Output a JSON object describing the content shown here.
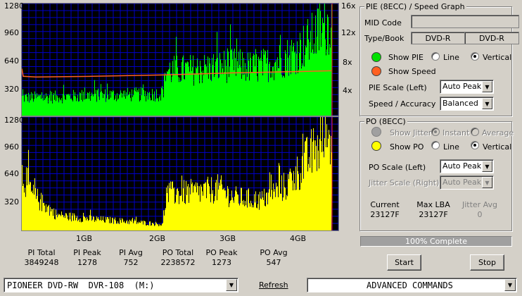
{
  "pie_graph": {
    "y_left": [
      "1280",
      "960",
      "640",
      "320"
    ],
    "y_right": [
      "16x",
      "12x",
      "8x",
      "4x"
    ]
  },
  "po_graph": {
    "y_left": [
      "1280",
      "960",
      "640",
      "320"
    ],
    "x_labels": [
      "1GB",
      "2GB",
      "3GB",
      "4GB"
    ]
  },
  "chart_data": [
    {
      "type": "area",
      "series": [
        {
          "name": "PIE",
          "color": "#00ff00",
          "x": [
            0,
            0.5,
            1.0,
            1.5,
            2.0,
            2.05,
            2.5,
            3.0,
            3.3,
            3.6,
            3.9,
            4.2,
            4.4
          ],
          "values": [
            240,
            250,
            270,
            280,
            290,
            600,
            620,
            680,
            640,
            720,
            850,
            1100,
            1270
          ]
        },
        {
          "name": "Speed",
          "color": "#ff6020",
          "x": [
            0,
            0.02,
            0.2,
            1.0,
            2.0,
            3.0,
            4.0,
            4.4
          ],
          "values": [
            6.7,
            5.6,
            5.5,
            5.6,
            5.8,
            6.1,
            6.3,
            6.4
          ]
        }
      ],
      "ylim": [
        0,
        1280
      ],
      "y2lim": [
        0,
        16
      ]
    },
    {
      "type": "area",
      "series": [
        {
          "name": "PO",
          "color": "#ffff00",
          "x": [
            0,
            0.15,
            0.5,
            1.0,
            1.5,
            2.0,
            2.05,
            2.6,
            2.8,
            3.0,
            3.4,
            3.8,
            4.1,
            4.4
          ],
          "values": [
            780,
            470,
            200,
            150,
            120,
            80,
            480,
            520,
            560,
            440,
            400,
            620,
            1000,
            1273
          ]
        }
      ],
      "xlim": [
        0,
        4.5
      ],
      "ylim": [
        0,
        1280
      ]
    }
  ],
  "stats": [
    {
      "label": "PI Total",
      "value": "3849248"
    },
    {
      "label": "PI Peak",
      "value": "1278"
    },
    {
      "label": "PI Avg",
      "value": "752"
    },
    {
      "label": "PO Total",
      "value": "2238572"
    },
    {
      "label": "PO Peak",
      "value": "1273"
    },
    {
      "label": "PO Avg",
      "value": "547"
    }
  ],
  "pie_panel": {
    "title": "PIE (8ECC) / Speed Graph",
    "mid_code_label": "MID Code",
    "mid_code_value": "",
    "type_book_label": "Type/Book",
    "type_value": "DVD-R",
    "book_value": "DVD-R",
    "show_pie": "Show PIE",
    "show_speed": "Show Speed",
    "line": "Line",
    "vertical": "Vertical",
    "pie_scale_label": "PIE Scale (Left)",
    "pie_scale_value": "Auto Peak",
    "speed_accuracy_label": "Speed / Accuracy",
    "speed_accuracy_value": "Balanced",
    "pie_color": "#00e000",
    "speed_color": "#ff6020"
  },
  "po_panel": {
    "title": "PO (8ECC)",
    "show_jitter": "Show Jitter",
    "instant": "Instant",
    "average": "Average",
    "show_po": "Show PO",
    "line": "Line",
    "vertical": "Vertical",
    "po_scale_label": "PO Scale (Left)",
    "po_scale_value": "Auto Peak",
    "jitter_scale_label": "Jitter Scale (Right)",
    "jitter_scale_value": "Auto Peak",
    "current_label": "Current",
    "current_value": "23127F",
    "max_lba_label": "Max LBA",
    "max_lba_value": "23127F",
    "jitter_avg_label": "Jitter Avg",
    "jitter_avg_value": "0",
    "po_color": "#ffff00"
  },
  "progress": {
    "text": "100% Complete",
    "value": 1.0
  },
  "buttons": {
    "start": "Start",
    "stop": "Stop"
  },
  "bottom": {
    "drive": "PIONEER DVD-RW  DVR-108  (M:)",
    "refresh": "Refresh",
    "advanced": "ADVANCED COMMANDS"
  }
}
